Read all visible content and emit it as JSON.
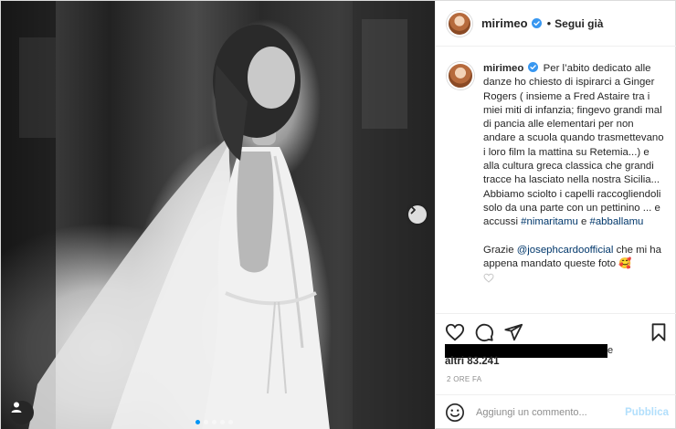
{
  "header": {
    "username": "mirimeo",
    "separator": "•",
    "follow_label": "Segui già"
  },
  "caption": {
    "username": "mirimeo",
    "text_1": "Per l’abito dedicato alle danze ho chiesto di ispirarci a Ginger Rogers ( insieme a Fred Astaire tra i miei miti di infanzia; fingevo grandi mal di pancia alle elementari per non andare a scuola quando trasmettevano i loro film la mattina su Retemia...) e alla cultura greca classica che grandi tracce ha lasciato nella nostra Sicilia... Abbiamo sciolto i capelli raccogliendoli solo da una parte con un pettinino ... e accussi ",
    "hashtag_1": "#nimaritamu",
    "between_hashtags": " e ",
    "hashtag_2": "#abballamu",
    "para2_before": "Grazie ",
    "mention": "@josephcardoofficial",
    "para2_after": " che mi ha appena mandato queste foto 🥰"
  },
  "likes": {
    "tail": "e",
    "count": "altri 83.241"
  },
  "timestamp": "2 ore fa",
  "comment": {
    "placeholder": "Aggiungi un commento...",
    "publish_label": "Pubblica"
  },
  "icons": {
    "verified": "verified-badge-icon",
    "like": "heart-icon",
    "comment": "comment-bubble-icon",
    "share": "paper-plane-icon",
    "save": "bookmark-icon",
    "emoji": "smiley-face-icon",
    "next": "chevron-right-icon",
    "user_tag": "user-tag-icon",
    "small_heart": "comment-like-heart-icon"
  },
  "colors": {
    "accent_blue": "#0095f6",
    "link_blue": "#00376b",
    "publish_disabled": "#b2dffc",
    "muted_text": "#8e8e8e"
  },
  "carousel": {
    "total": 5,
    "active_index": 0
  }
}
